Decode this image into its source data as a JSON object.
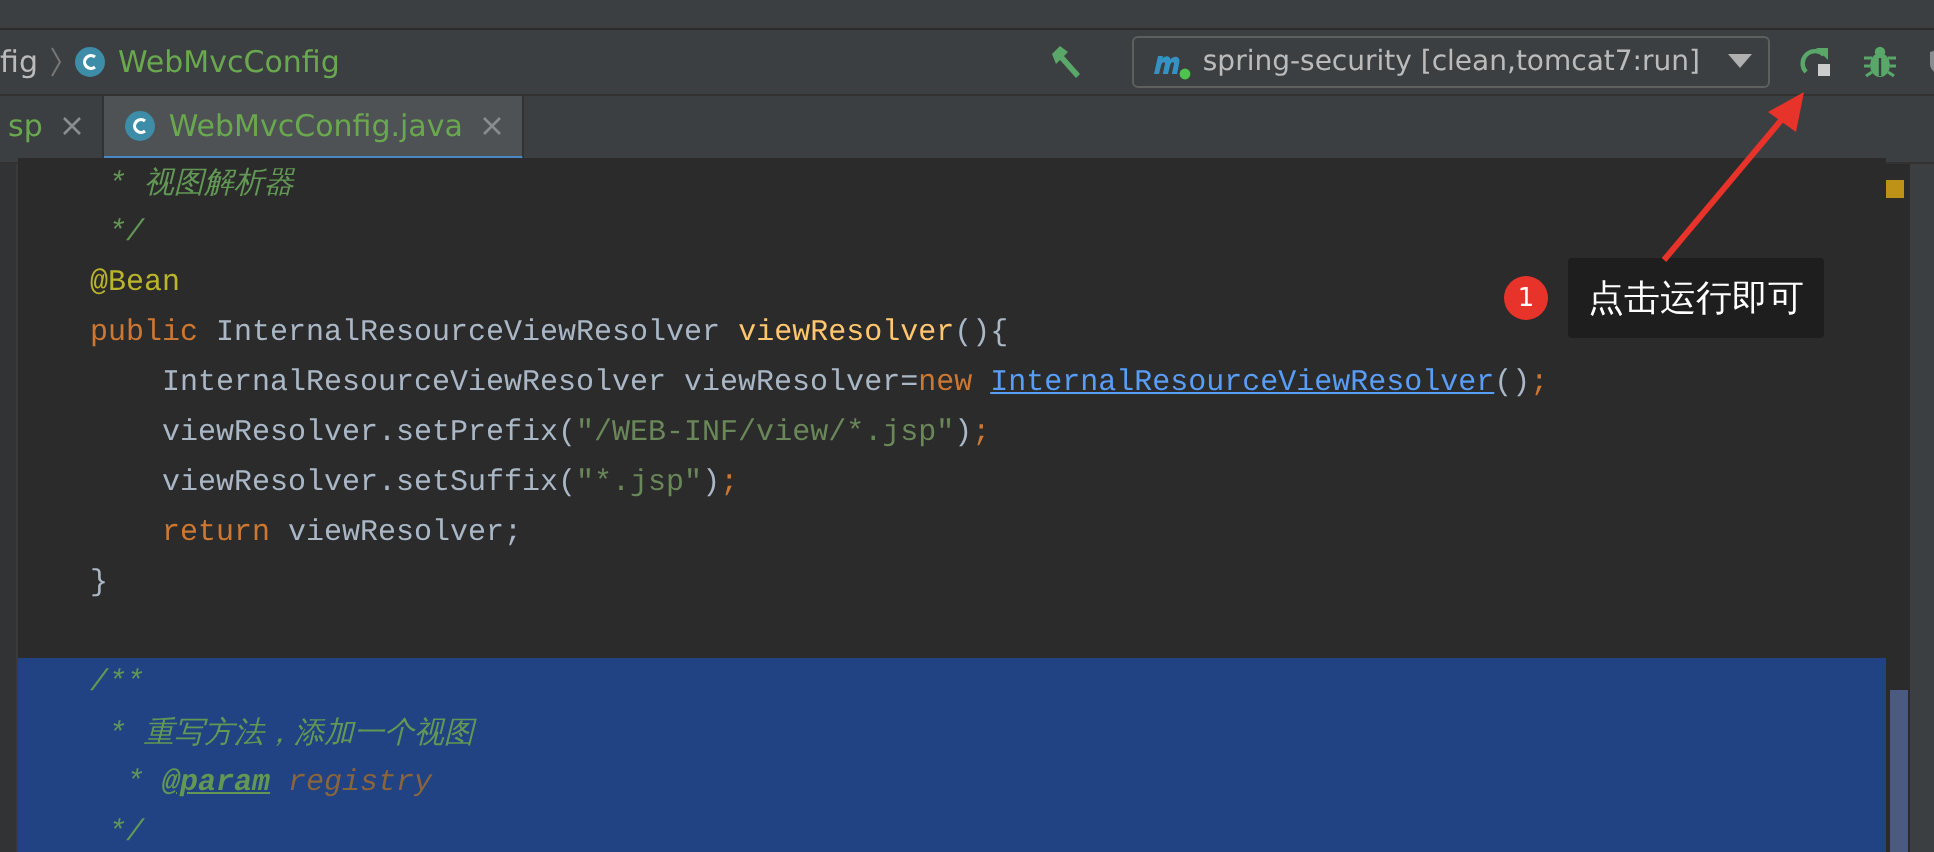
{
  "navbar": {
    "breadcrumbs": [
      {
        "text": "fig",
        "kind": "plain"
      },
      {
        "text": "WebMvcConfig",
        "kind": "class"
      }
    ],
    "run_config": {
      "text": "spring-security [clean,tomcat7:run]"
    }
  },
  "tabs": [
    {
      "label": "sp",
      "selected": false,
      "kind": "plain"
    },
    {
      "label": "WebMvcConfig.java",
      "selected": true,
      "kind": "class"
    }
  ],
  "editor": {
    "lines": [
      {
        "selected": false,
        "tokens": [
          {
            "text": " * 视图解析器",
            "kind": "comment"
          }
        ]
      },
      {
        "selected": false,
        "tokens": [
          {
            "text": " */",
            "kind": "comment"
          }
        ]
      },
      {
        "selected": false,
        "tokens": [
          {
            "text": "@Bean",
            "kind": "annotation"
          }
        ]
      },
      {
        "selected": false,
        "tokens": [
          {
            "text": "public",
            "kind": "keyword"
          },
          {
            "text": " InternalResourceViewResolver ",
            "kind": "plain"
          },
          {
            "text": "viewResolver",
            "kind": "method"
          },
          {
            "text": "(){",
            "kind": "plain"
          }
        ]
      },
      {
        "selected": false,
        "tokens": [
          {
            "text": "    InternalResourceViewResolver viewResolver=",
            "kind": "plain"
          },
          {
            "text": "new ",
            "kind": "keyword"
          },
          {
            "text": "InternalResourceViewResolver",
            "kind": "link"
          },
          {
            "text": "()",
            "kind": "plain"
          },
          {
            "text": ";",
            "kind": "keyword"
          }
        ]
      },
      {
        "selected": false,
        "tokens": [
          {
            "text": "    viewResolver.setPrefix(",
            "kind": "plain"
          },
          {
            "text": "\"/WEB-INF/view/*.jsp\"",
            "kind": "string"
          },
          {
            "text": ")",
            "kind": "plain"
          },
          {
            "text": ";",
            "kind": "keyword"
          }
        ]
      },
      {
        "selected": false,
        "tokens": [
          {
            "text": "    viewResolver.setSuffix(",
            "kind": "plain"
          },
          {
            "text": "\"*.jsp\"",
            "kind": "string"
          },
          {
            "text": ")",
            "kind": "plain"
          },
          {
            "text": ";",
            "kind": "keyword"
          }
        ]
      },
      {
        "selected": false,
        "tokens": [
          {
            "text": "    return",
            "kind": "keyword"
          },
          {
            "text": " viewResolver;",
            "kind": "plain"
          }
        ]
      },
      {
        "selected": false,
        "blank_after": true,
        "tokens": [
          {
            "text": "}",
            "kind": "plain"
          }
        ]
      },
      {
        "selected": true,
        "tokens": [
          {
            "text": "/**",
            "kind": "comment"
          }
        ]
      },
      {
        "selected": true,
        "tokens": [
          {
            "text": " * 重写方法，添加一个视图",
            "kind": "comment"
          }
        ]
      },
      {
        "selected": true,
        "tokens": [
          {
            "text": "  * ",
            "kind": "comment"
          },
          {
            "text": "@param",
            "kind": "doctag"
          },
          {
            "text": " registry",
            "kind": "docparam"
          }
        ]
      },
      {
        "selected": true,
        "tokens": [
          {
            "text": " */",
            "kind": "comment"
          }
        ]
      }
    ]
  },
  "annotation": {
    "badge": "1",
    "text": "点击运行即可"
  }
}
